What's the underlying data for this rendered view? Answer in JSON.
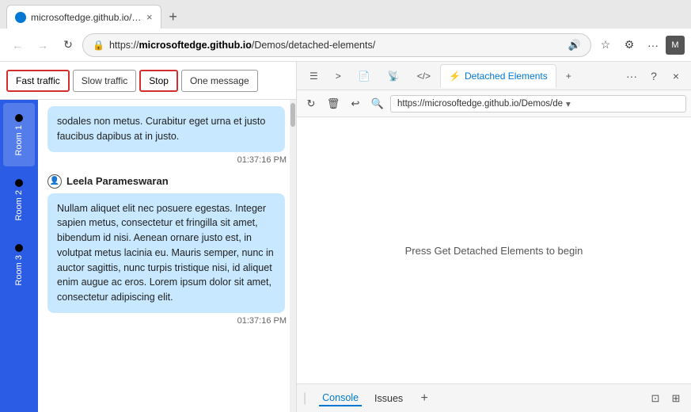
{
  "browser": {
    "tab_url": "microsoftedge.github.io/Demos/c...",
    "favicon_color": "#0078d4",
    "close_tab_icon": "×",
    "new_tab_icon": "+",
    "back_icon": "←",
    "forward_icon": "→",
    "refresh_icon": "↻",
    "address_url_prefix": "https://",
    "address_url_bold": "microsoftedge.github.io",
    "address_url_suffix": "/Demos/detached-elements/",
    "address_url_full": "https://microsoftedge.github.io/Demos/detached-elements/",
    "settings_icon": "⚙",
    "nav_more_icon": "...",
    "profile_icon": "👤",
    "minimize_icon": "—",
    "maximize_icon": "□",
    "close_win_icon": "×"
  },
  "toolbar": {
    "fast_traffic_label": "Fast traffic",
    "slow_traffic_label": "Slow traffic",
    "stop_label": "Stop",
    "one_message_label": "One message"
  },
  "rooms": [
    {
      "label": "Room 1",
      "active": true
    },
    {
      "label": "Room 2",
      "active": false
    },
    {
      "label": "Room 3",
      "active": false
    }
  ],
  "messages": [
    {
      "text": "sodales non metus. Curabitur eget urna et justo faucibus dapibus at in justo.",
      "time": "01:37:16 PM",
      "sender": null
    },
    {
      "sender": "Leela Parameswaran",
      "text": "Nullam aliquet elit nec posuere egestas. Integer sapien metus, consectetur et fringilla sit amet, bibendum id nisi. Aenean ornare justo est, in volutpat metus lacinia eu. Mauris semper, nunc in auctor sagittis, nunc turpis tristique nisi, id aliquet enim augue ac eros. Lorem ipsum dolor sit amet, consectetur adipiscing elit.",
      "time": "01:37:16 PM"
    }
  ],
  "devtools": {
    "tabs": [
      {
        "label": "Elements",
        "icon": "☰"
      },
      {
        "label": "Console",
        "icon": ">"
      },
      {
        "label": "Sources",
        "icon": "📄"
      },
      {
        "label": "Network",
        "icon": "📡"
      },
      {
        "label": "HTML",
        "icon": "</>"
      },
      {
        "label": "Detached Elements",
        "icon": "⚡",
        "active": true
      }
    ],
    "add_tab_icon": "+",
    "more_icon": "...",
    "help_icon": "?",
    "close_icon": "×",
    "nav_url": "https://microsoftedge.github.io/Demos/de",
    "nav_url_arrow": "▾",
    "refresh_icon": "↻",
    "delete_icon": "🗑",
    "undo_icon": "↩",
    "search_icon": "🔍",
    "hint_text": "Press Get Detached Elements to begin",
    "bottom_tabs": [
      "Console",
      "Issues"
    ],
    "bottom_add_icon": "+",
    "bottom_icon1": "⊡",
    "bottom_icon2": "⊞"
  }
}
